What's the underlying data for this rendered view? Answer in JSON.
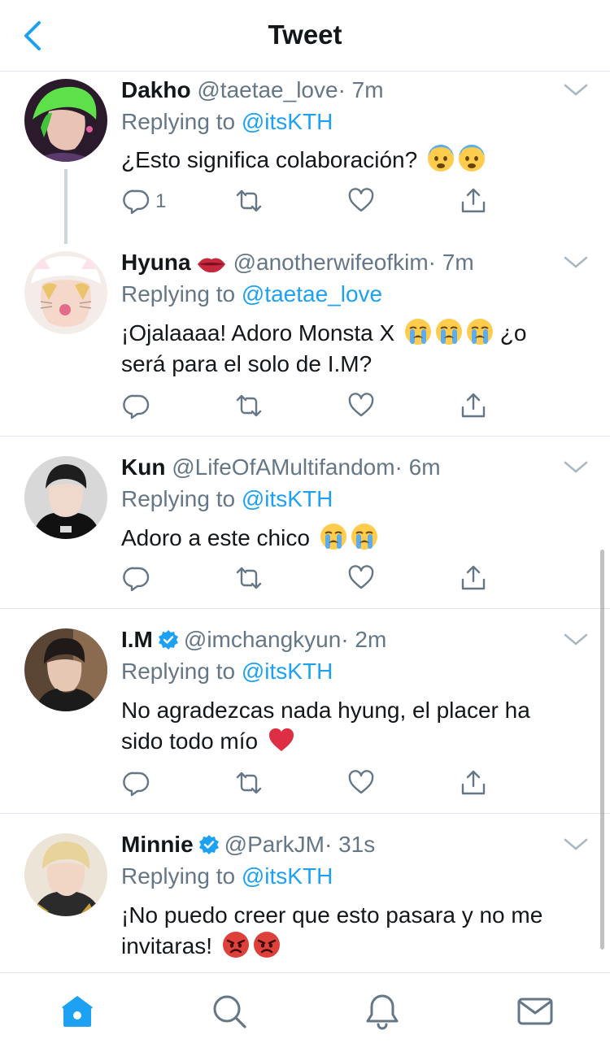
{
  "header": {
    "title": "Tweet",
    "back_icon": "chevron-left-icon"
  },
  "colors": {
    "accent": "#1da1f2",
    "muted": "#657786",
    "text": "#14171a",
    "divider": "#e1e8ed"
  },
  "tweets": [
    {
      "name": "Dakho",
      "handle": "@taetae_love",
      "time": "· 7m",
      "replying_prefix": "Replying to",
      "replying_to": "@itsKTH",
      "text_lines": [
        "¿Esto significa colaboración?"
      ],
      "emojis": [
        "fearful-face",
        "fearful-face"
      ],
      "reply_count": "1"
    },
    {
      "name": "Hyuna",
      "name_emoji": "lips",
      "handle": "@anotherwifeofkim",
      "time": "· 7m",
      "replying_prefix": "Replying to",
      "replying_to": "@taetae_love",
      "text_line1": "¡Ojalaaaa! Adoro Monsta X",
      "text_line1_tail": "¿o",
      "text_line2": "será para el solo de I.M?",
      "emojis": [
        "crying-face",
        "crying-face",
        "crying-face"
      ]
    },
    {
      "name": "Kun",
      "handle": "@LifeOfAMultifandom",
      "time": "· 6m",
      "replying_prefix": "Replying to",
      "replying_to": "@itsKTH",
      "text_line1": "Adoro a este chico",
      "emojis": [
        "crying-face",
        "crying-face"
      ]
    },
    {
      "name": "I.M",
      "verified": true,
      "handle": "@imchangkyun",
      "time": "· 2m",
      "replying_prefix": "Replying to",
      "replying_to": "@itsKTH",
      "text_line1": "No agradezcas nada hyung, el placer ha",
      "text_line2": "sido todo mío",
      "emojis": [
        "red-heart"
      ]
    },
    {
      "name": "Minnie",
      "verified": true,
      "handle": "@ParkJM",
      "time": "· 31s",
      "replying_prefix": "Replying to",
      "replying_to": "@itsKTH",
      "text_line1": "¡No puedo creer que esto pasara y no me",
      "text_line2": "invitaras!",
      "emojis": [
        "angry-face",
        "angry-face"
      ]
    }
  ],
  "tabbar": {
    "items": [
      "home-icon",
      "search-icon",
      "notifications-icon",
      "messages-icon"
    ],
    "active": "home-icon"
  }
}
